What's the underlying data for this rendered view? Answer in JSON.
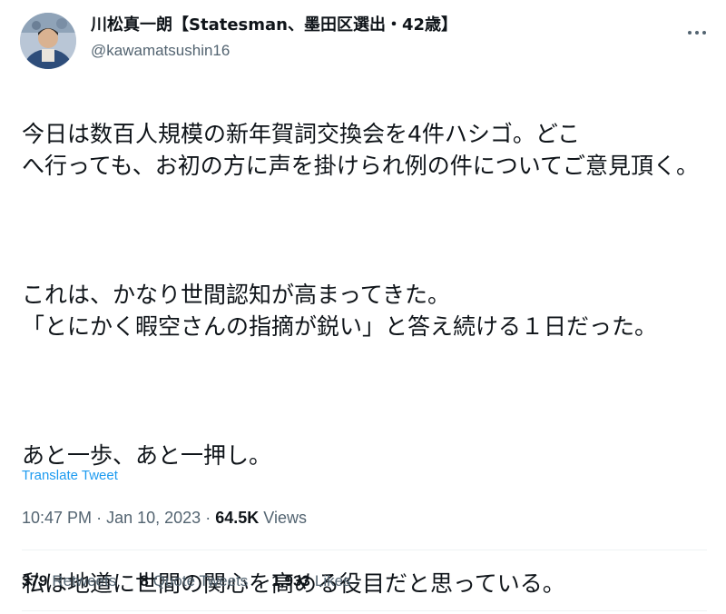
{
  "author": {
    "display_name": "川松真一朗【Statesman、墨田区選出・42歳】",
    "handle": "@kawamatsushin16",
    "avatar_icon": "profile-photo"
  },
  "more_icon": "more-dots-icon",
  "tweet": {
    "paragraphs": [
      "今日は数百人規模の新年賀詞交換会を4件ハシゴ。どこ\nへ行っても、お初の方に声を掛けられ例の件についてご意見頂く。",
      "これは、かなり世間認知が高まってきた。\n「とにかく暇空さんの指摘が鋭い」と答え続ける１日だった。",
      "あと一歩、あと一押し。",
      "私は地道に世間の関心を高める役目だと思っている。"
    ],
    "translate_label": "Translate Tweet",
    "time": "10:47 PM",
    "separator": "·",
    "date": "Jan 10, 2023",
    "views_count": "64.5K",
    "views_label": "Views"
  },
  "stats": {
    "retweets_count": "379",
    "retweets_label": "Retweets",
    "quotes_count": "8",
    "quotes_label": "Quote Tweets",
    "likes_count": "1,933",
    "likes_label": "Likes"
  },
  "colors": {
    "link": "#1d9bf0",
    "secondary_text": "#536471",
    "primary_text": "#0f1419",
    "divider": "#eff3f4"
  }
}
